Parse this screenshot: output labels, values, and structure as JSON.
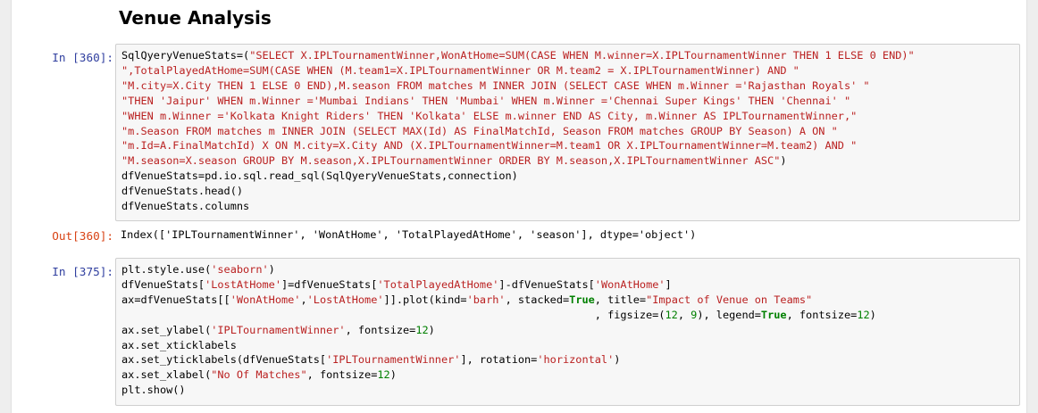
{
  "heading": "Venue Analysis",
  "cells": {
    "cell1": {
      "prompt_in": "In [360]:",
      "prompt_out": "Out[360]:",
      "lines": [
        [
          {
            "t": "SqlQyeryVenueStats=(",
            "c": ""
          },
          {
            "t": "\"SELECT X.IPLTournamentWinner,WonAtHome=SUM(CASE WHEN M.winner=X.IPLTournamentWinner THEN 1 ELSE 0 END)\"",
            "c": "s"
          }
        ],
        [
          {
            "t": "\",TotalPlayedAtHome=SUM(CASE WHEN (M.team1=X.IPLTournamentWinner OR M.team2 = X.IPLTournamentWinner) AND \"",
            "c": "s"
          }
        ],
        [
          {
            "t": "\"M.city=X.City THEN 1 ELSE 0 END),M.season FROM matches M INNER JOIN (SELECT CASE WHEN m.Winner ='Rajasthan Royals' \"",
            "c": "s"
          }
        ],
        [
          {
            "t": "\"THEN 'Jaipur' WHEN m.Winner ='Mumbai Indians' THEN 'Mumbai' WHEN m.Winner ='Chennai Super Kings' THEN 'Chennai' \"",
            "c": "s"
          }
        ],
        [
          {
            "t": "\"WHEN m.Winner ='Kolkata Knight Riders' THEN 'Kolkata' ELSE m.winner END AS City, m.Winner AS IPLTournamentWinner,\"",
            "c": "s"
          }
        ],
        [
          {
            "t": "\"m.Season FROM matches m INNER JOIN (SELECT MAX(Id) AS FinalMatchId, Season FROM matches GROUP BY Season) A ON \"",
            "c": "s"
          }
        ],
        [
          {
            "t": "\"m.Id=A.FinalMatchId) X ON M.city=X.City AND (X.IPLTournamentWinner=M.team1 OR X.IPLTournamentWinner=M.team2) AND \"",
            "c": "s"
          }
        ],
        [
          {
            "t": "\"M.season=X.season GROUP BY M.season,X.IPLTournamentWinner ORDER BY M.season,X.IPLTournamentWinner ASC\"",
            "c": "s"
          },
          {
            "t": ")",
            "c": ""
          }
        ],
        [
          {
            "t": "dfVenueStats=pd.io.sql.read_sql(SqlQyeryVenueStats,connection)",
            "c": ""
          }
        ],
        [
          {
            "t": "dfVenueStats.head()",
            "c": ""
          }
        ],
        [
          {
            "t": "dfVenueStats.columns",
            "c": ""
          }
        ]
      ],
      "output": "Index(['IPLTournamentWinner', 'WonAtHome', 'TotalPlayedAtHome', 'season'], dtype='object')"
    },
    "cell2": {
      "prompt_in": "In [375]:",
      "lines": [
        [
          {
            "t": "plt.style.use(",
            "c": ""
          },
          {
            "t": "'seaborn'",
            "c": "s"
          },
          {
            "t": ")",
            "c": ""
          }
        ],
        [
          {
            "t": "dfVenueStats[",
            "c": ""
          },
          {
            "t": "'LostAtHome'",
            "c": "s"
          },
          {
            "t": "]=dfVenueStats[",
            "c": ""
          },
          {
            "t": "'TotalPlayedAtHome'",
            "c": "s"
          },
          {
            "t": "]-dfVenueStats[",
            "c": ""
          },
          {
            "t": "'WonAtHome'",
            "c": "s"
          },
          {
            "t": "]",
            "c": ""
          }
        ],
        [
          {
            "t": "ax=dfVenueStats[[",
            "c": ""
          },
          {
            "t": "'WonAtHome'",
            "c": "s"
          },
          {
            "t": ",",
            "c": ""
          },
          {
            "t": "'LostAtHome'",
            "c": "s"
          },
          {
            "t": "]].plot(kind=",
            "c": ""
          },
          {
            "t": "'barh'",
            "c": "s"
          },
          {
            "t": ", stacked=",
            "c": ""
          },
          {
            "t": "True",
            "c": "k"
          },
          {
            "t": ", title=",
            "c": ""
          },
          {
            "t": "\"Impact of Venue on Teams\"",
            "c": "s"
          }
        ],
        [
          {
            "t": "                                                                          , figsize=(",
            "c": ""
          },
          {
            "t": "12",
            "c": "n"
          },
          {
            "t": ", ",
            "c": ""
          },
          {
            "t": "9",
            "c": "n"
          },
          {
            "t": "), legend=",
            "c": ""
          },
          {
            "t": "True",
            "c": "k"
          },
          {
            "t": ", fontsize=",
            "c": ""
          },
          {
            "t": "12",
            "c": "n"
          },
          {
            "t": ")",
            "c": ""
          }
        ],
        [
          {
            "t": "ax.set_ylabel(",
            "c": ""
          },
          {
            "t": "'IPLTournamentWinner'",
            "c": "s"
          },
          {
            "t": ", fontsize=",
            "c": ""
          },
          {
            "t": "12",
            "c": "n"
          },
          {
            "t": ")",
            "c": ""
          }
        ],
        [
          {
            "t": "ax.set_xticklabels",
            "c": ""
          }
        ],
        [
          {
            "t": "ax.set_yticklabels(dfVenueStats[",
            "c": ""
          },
          {
            "t": "'IPLTournamentWinner'",
            "c": "s"
          },
          {
            "t": "], rotation=",
            "c": ""
          },
          {
            "t": "'horizontal'",
            "c": "s"
          },
          {
            "t": ")",
            "c": ""
          }
        ],
        [
          {
            "t": "ax.set_xlabel(",
            "c": ""
          },
          {
            "t": "\"No Of Matches\"",
            "c": "s"
          },
          {
            "t": ", fontsize=",
            "c": ""
          },
          {
            "t": "12",
            "c": "n"
          },
          {
            "t": ")",
            "c": ""
          }
        ],
        [
          {
            "t": "plt.show()",
            "c": ""
          }
        ]
      ]
    }
  }
}
